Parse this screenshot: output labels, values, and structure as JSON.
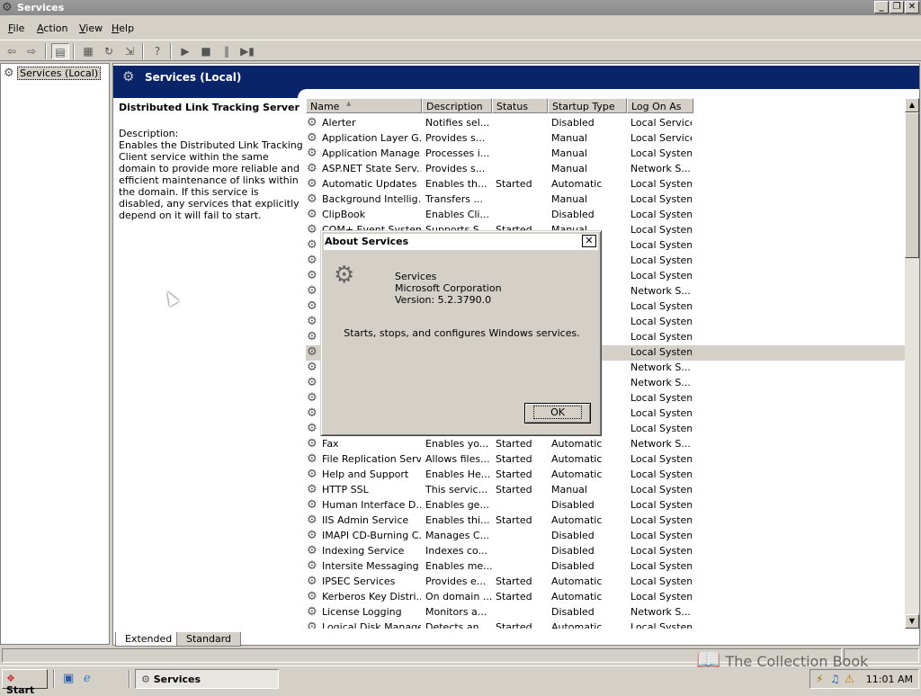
{
  "window": {
    "title": "Services",
    "buttons": [
      "_",
      "❐",
      "✕"
    ]
  },
  "menu": [
    {
      "label": "File",
      "accel": "F"
    },
    {
      "label": "Action",
      "accel": "A"
    },
    {
      "label": "View",
      "accel": "V"
    },
    {
      "label": "Help",
      "accel": "H"
    }
  ],
  "toolbar": {
    "icons": [
      "back-arrow-icon",
      "forward-arrow-icon",
      "show-hide-tree-icon",
      "properties-icon",
      "refresh-icon",
      "export-list-icon",
      "help-icon",
      "start-service-icon",
      "stop-service-icon",
      "pause-service-icon",
      "restart-service-icon"
    ]
  },
  "tree": {
    "root": "Services (Local)"
  },
  "panel": {
    "title": "Services (Local)"
  },
  "description": {
    "service_name": "Distributed Link Tracking Server",
    "label": "Description:",
    "text": "Enables the Distributed Link Tracking Client service within the same domain to provide more reliable and efficient maintenance of links within the domain. If this service is disabled, any services that explicitly depend on it will fail to start."
  },
  "list": {
    "columns": [
      "Name",
      "Description",
      "Status",
      "Startup Type",
      "Log On As"
    ],
    "sort_indicator": "▲",
    "rows": [
      [
        "Alerter",
        "Notifies sel...",
        "",
        "Disabled",
        "Local Service"
      ],
      [
        "Application Layer G...",
        "Provides s...",
        "",
        "Manual",
        "Local Service"
      ],
      [
        "Application Manage...",
        "Processes i...",
        "",
        "Manual",
        "Local System"
      ],
      [
        "ASP.NET State Serv...",
        "Provides s...",
        "",
        "Manual",
        "Network S..."
      ],
      [
        "Automatic Updates",
        "Enables th...",
        "Started",
        "Automatic",
        "Local System"
      ],
      [
        "Background Intellig...",
        "Transfers ...",
        "",
        "Manual",
        "Local System"
      ],
      [
        "ClipBook",
        "Enables Cli...",
        "",
        "Disabled",
        "Local System"
      ],
      [
        "COM+ Event System",
        "Supports S...",
        "Started",
        "Manual",
        "Local System"
      ],
      [
        "",
        "",
        "",
        "",
        "Local System"
      ],
      [
        "",
        "",
        "",
        "",
        "Local System"
      ],
      [
        "",
        "",
        "",
        "",
        "Local System"
      ],
      [
        "",
        "",
        "",
        "",
        "Network S..."
      ],
      [
        "",
        "",
        "",
        "",
        "Local System"
      ],
      [
        "",
        "",
        "",
        "",
        "Local System"
      ],
      [
        "",
        "",
        "",
        "",
        "Local System"
      ],
      [
        "",
        "",
        "",
        "",
        "Local System"
      ],
      [
        "",
        "",
        "",
        "",
        "Network S..."
      ],
      [
        "",
        "",
        "",
        "",
        "Network S..."
      ],
      [
        "",
        "",
        "",
        "",
        "Local System"
      ],
      [
        "",
        "",
        "",
        "",
        "Local System"
      ],
      [
        "",
        "",
        "",
        "",
        "Local System"
      ],
      [
        "Fax",
        "Enables yo...",
        "Started",
        "Automatic",
        "Network S..."
      ],
      [
        "File Replication Serv...",
        "Allows files...",
        "Started",
        "Automatic",
        "Local System"
      ],
      [
        "Help and Support",
        "Enables He...",
        "Started",
        "Automatic",
        "Local System"
      ],
      [
        "HTTP SSL",
        "This servic...",
        "Started",
        "Manual",
        "Local System"
      ],
      [
        "Human Interface D...",
        "Enables ge...",
        "",
        "Disabled",
        "Local System"
      ],
      [
        "IIS Admin Service",
        "Enables thi...",
        "Started",
        "Automatic",
        "Local System"
      ],
      [
        "IMAPI CD-Burning C...",
        "Manages C...",
        "",
        "Disabled",
        "Local System"
      ],
      [
        "Indexing Service",
        "Indexes co...",
        "",
        "Disabled",
        "Local System"
      ],
      [
        "Intersite Messaging",
        "Enables me...",
        "",
        "Disabled",
        "Local System"
      ],
      [
        "IPSEC Services",
        "Provides e...",
        "Started",
        "Automatic",
        "Local System"
      ],
      [
        "Kerberos Key Distri...",
        "On domain ...",
        "Started",
        "Automatic",
        "Local System"
      ],
      [
        "License Logging",
        "Monitors a...",
        "",
        "Disabled",
        "Network S..."
      ],
      [
        "Logical Disk Manager",
        "Detects an...",
        "Started",
        "Automatic",
        "Local System"
      ]
    ],
    "selected_row": 15
  },
  "tabs": [
    "Extended",
    "Standard"
  ],
  "dialog": {
    "title": "About Services",
    "close": "✕",
    "app": "Services",
    "company": "Microsoft Corporation",
    "version": "Version: 5.2.3790.0",
    "message": "Starts, stops, and configures Windows services.",
    "ok": "OK"
  },
  "taskbar": {
    "start": "Start",
    "task": "Services",
    "clock": "11:01 AM"
  },
  "watermark": "The Collection Book",
  "colors": {
    "panel_header": "#0a246a",
    "face": "#d4d0c8",
    "selection": "#d4d0c8"
  }
}
